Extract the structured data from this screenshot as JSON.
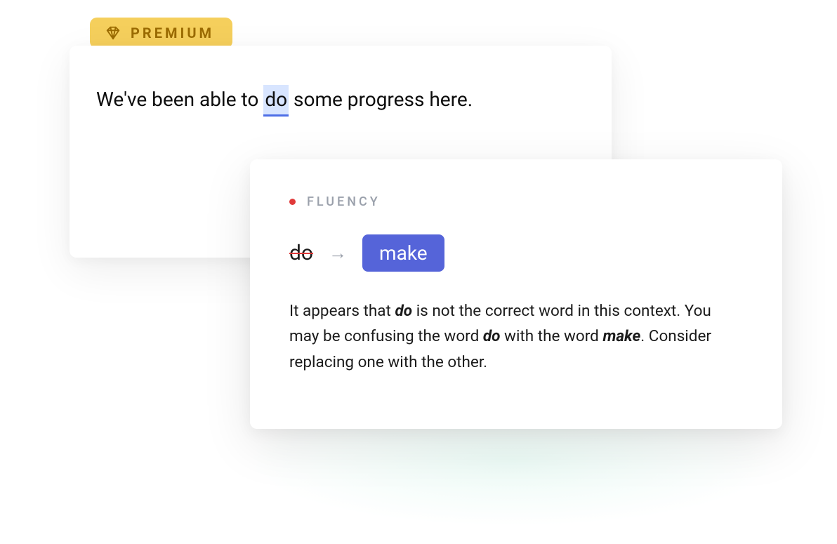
{
  "badge": {
    "label": "PREMIUM"
  },
  "editor": {
    "sentence": {
      "pre": "We've been able to ",
      "highlighted": "do",
      "post": " some progress here."
    }
  },
  "suggestion": {
    "category": "FLUENCY",
    "original": "do",
    "replacement": "make",
    "explanation": {
      "t1": "It appears that ",
      "w1": "do",
      "t2": " is not the correct word in this context. You may be confusing the word ",
      "w2": "do",
      "t3": " with the word ",
      "w3": "make",
      "t4": ". Consider replacing one with the other."
    }
  },
  "colors": {
    "badge_bg": "#f5cf5c",
    "badge_text": "#9b6b00",
    "highlight_bg": "#d8e5ff",
    "highlight_underline": "#4d6ee6",
    "category_dot": "#e03a3a",
    "pill_bg": "#5564d9"
  }
}
